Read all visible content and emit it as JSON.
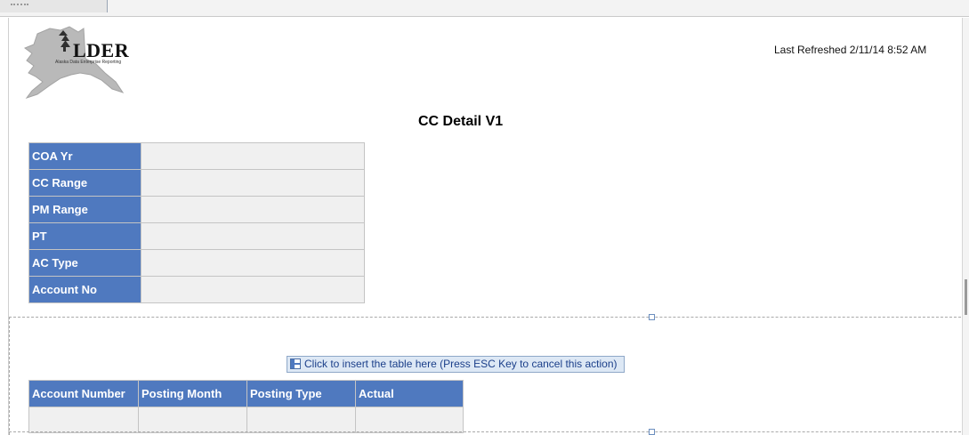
{
  "header": {
    "logo_text": "LDER",
    "logo_subtext": "Alaska Data Enterprise Reporting",
    "last_refreshed": "Last Refreshed 2/11/14 8:52 AM"
  },
  "report": {
    "title": "CC Detail V1"
  },
  "prompts": [
    {
      "label": "COA Yr",
      "value": ""
    },
    {
      "label": "CC Range",
      "value": ""
    },
    {
      "label": "PM Range",
      "value": ""
    },
    {
      "label": "PT",
      "value": ""
    },
    {
      "label": "AC Type",
      "value": ""
    },
    {
      "label": "Account No",
      "value": ""
    }
  ],
  "insert_prompt": "Click to insert the table here (Press ESC Key to cancel this action)",
  "table": {
    "columns": [
      "Account Number",
      "Posting Month",
      "Posting Type",
      "Actual"
    ],
    "rows": [
      [
        "",
        "",
        "",
        ""
      ]
    ]
  },
  "colors": {
    "header_blue": "#4f79bf",
    "cell_gray": "#f0f0f0"
  }
}
